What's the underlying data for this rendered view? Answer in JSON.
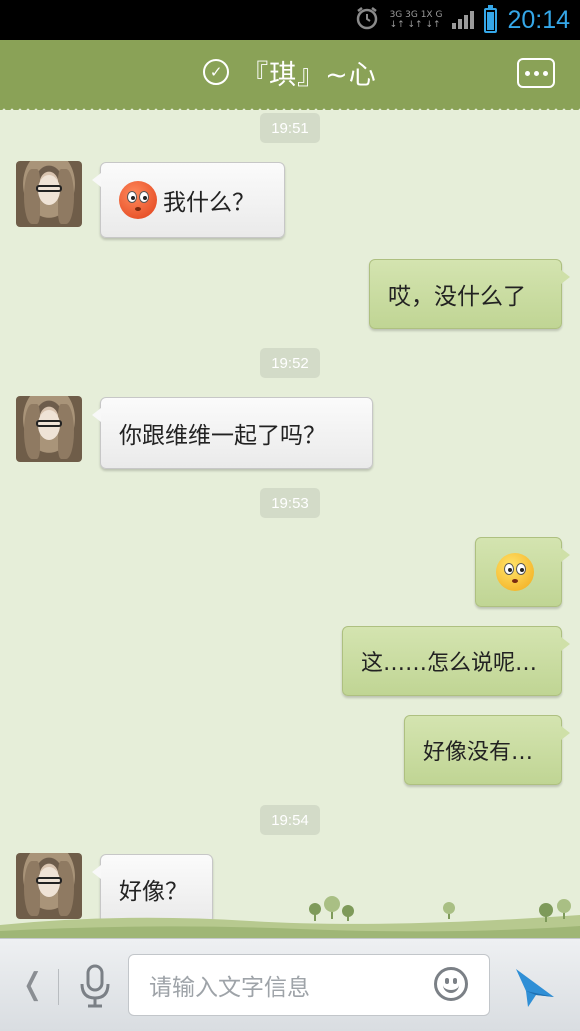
{
  "status_bar": {
    "time": "20:14",
    "network_top": "3G 3G 1X G",
    "network_bottom": "↓↑ ↓↑ ↓↑",
    "battery_level": 0.85
  },
  "header": {
    "title": "『琪』~心"
  },
  "messages": [
    {
      "type": "time",
      "text": "19:51"
    },
    {
      "type": "left",
      "emoji": "red-face",
      "text": "我什么？"
    },
    {
      "type": "right",
      "text": "哎，没什么了"
    },
    {
      "type": "time",
      "text": "19:52"
    },
    {
      "type": "left",
      "text": "你跟维维一起了吗？"
    },
    {
      "type": "time",
      "text": "19:53"
    },
    {
      "type": "right",
      "emoji": "yellow-face",
      "text": ""
    },
    {
      "type": "right",
      "text": "这……怎么说呢…"
    },
    {
      "type": "right",
      "text": "好像没有…"
    },
    {
      "type": "time",
      "text": "19:54"
    },
    {
      "type": "left",
      "text": "好像？"
    }
  ],
  "input": {
    "placeholder": "请输入文字信息"
  },
  "colors": {
    "header": "#8aa257",
    "background": "#e6eed9",
    "right_bubble": "#c7da9f",
    "left_bubble": "#f4f4f4",
    "accent_blue": "#35a7e8"
  }
}
